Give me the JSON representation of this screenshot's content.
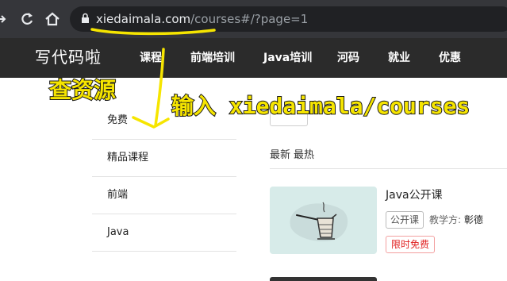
{
  "browser": {
    "url_host": "xiedaimala.com",
    "url_rest": "/courses#/?page=1"
  },
  "site": {
    "logo": "写代码啦",
    "nav": [
      "课程",
      "前端培训",
      "Java培训",
      "河码",
      "就业",
      "优惠"
    ]
  },
  "sidebar": {
    "items": [
      "免费",
      "精品课程",
      "前端",
      "Java"
    ]
  },
  "main": {
    "sort_latest": "最新",
    "sort_hottest": "最热",
    "course": {
      "title": "Java公开课",
      "tag_open": "公开课",
      "teacher_label": "教学方:",
      "teacher_name": "彰德",
      "tag_free": "限时免费"
    }
  },
  "annotations": {
    "lookup_source": "查资源",
    "instruction": "输入 xiedaimala/courses",
    "color": "#f6e500"
  },
  "colors": {
    "chrome": "#35363a",
    "nav_bg": "#2b2b2b",
    "free_tag": "#e02020",
    "thumb_bg": "#d7ebe9"
  }
}
